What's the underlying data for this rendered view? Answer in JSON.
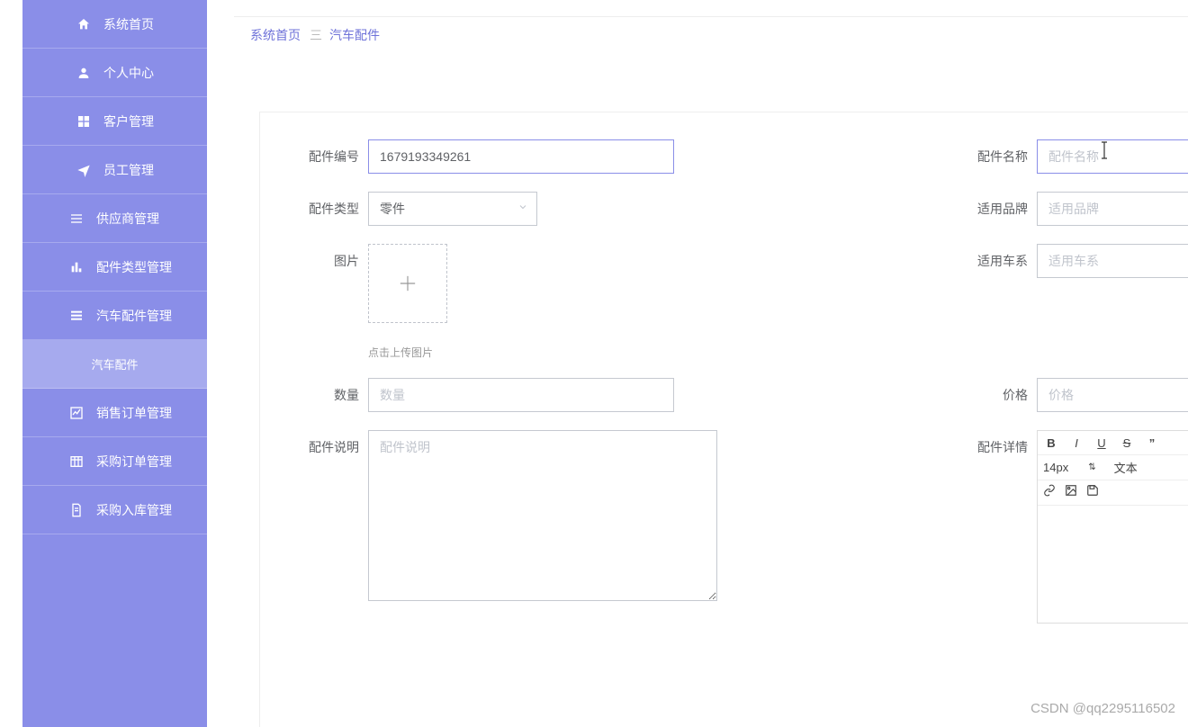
{
  "sidebar": {
    "items": [
      {
        "icon": "home",
        "label": "系统首页"
      },
      {
        "icon": "person",
        "label": "个人中心"
      },
      {
        "icon": "grid",
        "label": "客户管理"
      },
      {
        "icon": "plane",
        "label": "员工管理"
      },
      {
        "icon": "list",
        "label": "供应商管理"
      },
      {
        "icon": "bar",
        "label": "配件类型管理"
      },
      {
        "icon": "menu",
        "label": "汽车配件管理"
      },
      {
        "icon": "child",
        "label": "汽车配件"
      },
      {
        "icon": "chart",
        "label": "销售订单管理"
      },
      {
        "icon": "table",
        "label": "采购订单管理"
      },
      {
        "icon": "doc",
        "label": "采购入库管理"
      }
    ]
  },
  "breadcrumb": {
    "home": "系统首页",
    "sep": "三",
    "current": "汽车配件"
  },
  "form": {
    "part_number_label": "配件编号",
    "part_number_value": "1679193349261",
    "part_name_label": "配件名称",
    "part_name_placeholder": "配件名称",
    "part_type_label": "配件类型",
    "part_type_value": "零件",
    "brand_label": "适用品牌",
    "brand_placeholder": "适用品牌",
    "image_label": "图片",
    "image_hint": "点击上传图片",
    "series_label": "适用车系",
    "series_placeholder": "适用车系",
    "qty_label": "数量",
    "qty_placeholder": "数量",
    "price_label": "价格",
    "price_placeholder": "价格",
    "desc_label": "配件说明",
    "desc_placeholder": "配件说明",
    "detail_label": "配件详情",
    "editor_fontsize": "14px",
    "editor_text": "文本"
  },
  "watermark": "CSDN @qq2295116502"
}
